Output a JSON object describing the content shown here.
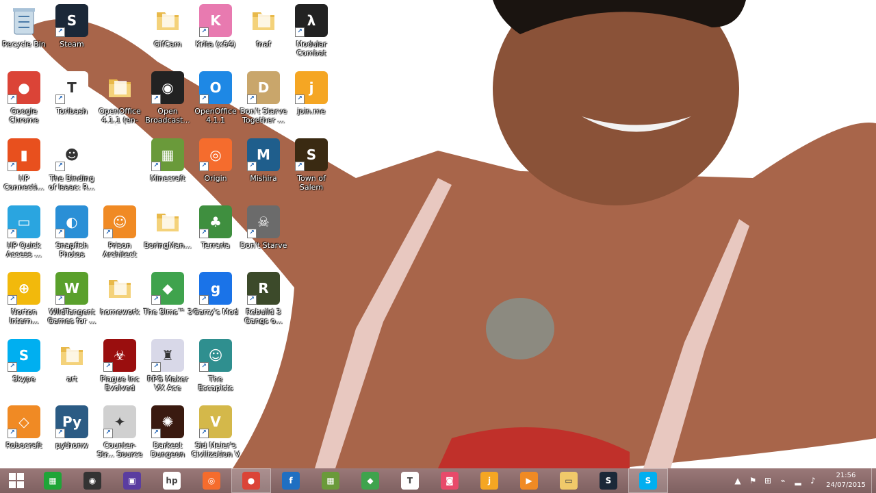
{
  "desktop": {
    "icons": [
      {
        "label": "Recycle Bin",
        "icon": "recycle-bin-icon",
        "color": "#8fb2cf",
        "glyph": "🗑",
        "shortcut": false
      },
      {
        "label": "Steam",
        "icon": "steam-icon",
        "color": "#1b2838",
        "glyph": "S",
        "shortcut": true
      },
      {
        "label": "GifCam",
        "icon": "folder-icon",
        "color": "#f0c96a",
        "glyph": "",
        "shortcut": false
      },
      {
        "label": "Krita (x64)",
        "icon": "krita-icon",
        "color": "#e87ab0",
        "glyph": "K",
        "shortcut": true
      },
      {
        "label": "fnaf",
        "icon": "folder-icon",
        "color": "#f0c96a",
        "glyph": "",
        "shortcut": false
      },
      {
        "label": "Modular Combat",
        "icon": "half-life-icon",
        "color": "#222222",
        "glyph": "λ",
        "shortcut": true
      },
      {
        "label": "Google Chrome",
        "icon": "chrome-icon",
        "color": "#db4437",
        "glyph": "●",
        "shortcut": true
      },
      {
        "label": "Toribash",
        "icon": "toribash-icon",
        "color": "#ffffff",
        "glyph": "T",
        "shortcut": true
      },
      {
        "label": "OpenOffice 4.1.1 (en-G...",
        "icon": "folder-icon",
        "color": "#f0c96a",
        "glyph": "",
        "shortcut": false
      },
      {
        "label": "Open Broadcast...",
        "icon": "obs-icon",
        "color": "#222222",
        "glyph": "◉",
        "shortcut": true
      },
      {
        "label": "OpenOffice 4.1.1",
        "icon": "openoffice-icon",
        "color": "#1e88e5",
        "glyph": "O",
        "shortcut": true
      },
      {
        "label": "Don't Starve Together ...",
        "icon": "dont-starve-together-icon",
        "color": "#c9a66b",
        "glyph": "D",
        "shortcut": true
      },
      {
        "label": "join.me",
        "icon": "joinme-icon",
        "color": "#f5a623",
        "glyph": "j",
        "shortcut": true
      },
      {
        "label": "HP Connecti...",
        "icon": "hp-connected-icon",
        "color": "#e8501e",
        "glyph": "▮",
        "shortcut": true
      },
      {
        "label": "The Binding of Isaac: R...",
        "icon": "isaac-icon",
        "color": "#ffffff",
        "glyph": "☻",
        "shortcut": true
      },
      {
        "label": "Minecraft",
        "icon": "minecraft-icon",
        "color": "#6a9a3a",
        "glyph": "▦",
        "shortcut": true
      },
      {
        "label": "Origin",
        "icon": "origin-icon",
        "color": "#f56c2d",
        "glyph": "◎",
        "shortcut": true
      },
      {
        "label": "Mishira",
        "icon": "mishira-icon",
        "color": "#1f5e8c",
        "glyph": "M",
        "shortcut": true
      },
      {
        "label": "Town of Salem",
        "icon": "town-of-salem-icon",
        "color": "#3a2a12",
        "glyph": "S",
        "shortcut": true
      },
      {
        "label": "HP Quick Access ...",
        "icon": "hp-quick-access-icon",
        "color": "#2aa5e0",
        "glyph": "▭",
        "shortcut": true
      },
      {
        "label": "Snapfish Photos",
        "icon": "snapfish-icon",
        "color": "#2a8fd6",
        "glyph": "◐",
        "shortcut": true
      },
      {
        "label": "Prison Architect",
        "icon": "prison-architect-icon",
        "color": "#f08a24",
        "glyph": "☺",
        "shortcut": true
      },
      {
        "label": "BoringMan...",
        "icon": "folder-icon",
        "color": "#f0c96a",
        "glyph": "",
        "shortcut": false
      },
      {
        "label": "Terraria",
        "icon": "terraria-icon",
        "color": "#3f8f3f",
        "glyph": "♣",
        "shortcut": true
      },
      {
        "label": "Don't Starve",
        "icon": "dont-starve-icon",
        "color": "#6b6b6b",
        "glyph": "☠",
        "shortcut": true
      },
      {
        "label": "Norton Intern...",
        "icon": "norton-icon",
        "color": "#f2b90c",
        "glyph": "⊕",
        "shortcut": true
      },
      {
        "label": "WildTangent Games for ...",
        "icon": "wildtangent-icon",
        "color": "#5aa02c",
        "glyph": "W",
        "shortcut": true
      },
      {
        "label": "homework",
        "icon": "folder-icon",
        "color": "#f0c96a",
        "glyph": "",
        "shortcut": false
      },
      {
        "label": "The Sims™ 3",
        "icon": "sims-icon",
        "color": "#3fa34d",
        "glyph": "◆",
        "shortcut": true
      },
      {
        "label": "Garry's Mod",
        "icon": "garrys-mod-icon",
        "color": "#1a73e8",
        "glyph": "g",
        "shortcut": true
      },
      {
        "label": "Rebuild 3 Gangs o...",
        "icon": "rebuild-icon",
        "color": "#3c4a2a",
        "glyph": "R",
        "shortcut": true
      },
      {
        "label": "Skype",
        "icon": "skype-icon",
        "color": "#00aff0",
        "glyph": "S",
        "shortcut": true
      },
      {
        "label": "art",
        "icon": "folder-icon",
        "color": "#f0c96a",
        "glyph": "",
        "shortcut": false
      },
      {
        "label": "Plague Inc Evolved",
        "icon": "plague-inc-icon",
        "color": "#9a0e0e",
        "glyph": "☣",
        "shortcut": true
      },
      {
        "label": "RPG Maker VX Ace",
        "icon": "rpg-maker-icon",
        "color": "#d8d8e8",
        "glyph": "♜",
        "shortcut": true
      },
      {
        "label": "The Escapists",
        "icon": "escapists-icon",
        "color": "#2f8f8f",
        "glyph": "☺",
        "shortcut": true
      },
      {
        "label": "Robocraft",
        "icon": "robocraft-icon",
        "color": "#f08a24",
        "glyph": "◇",
        "shortcut": true
      },
      {
        "label": "pythonw",
        "icon": "python-icon",
        "color": "#2b5b84",
        "glyph": "Py",
        "shortcut": true
      },
      {
        "label": "Counter-Str... Source",
        "icon": "counter-strike-icon",
        "color": "#d0d0d0",
        "glyph": "✦",
        "shortcut": true
      },
      {
        "label": "Darkest Dungeon",
        "icon": "darkest-dungeon-icon",
        "color": "#3a1a10",
        "glyph": "✺",
        "shortcut": true
      },
      {
        "label": "Sid Meier's Civilization V",
        "icon": "civilization-icon",
        "color": "#d4b84a",
        "glyph": "V",
        "shortcut": true
      }
    ]
  },
  "taskbar": {
    "buttons": [
      {
        "name": "store-icon",
        "color": "#1fa538",
        "glyph": "▦",
        "active": false
      },
      {
        "name": "camera-app-icon",
        "color": "#333333",
        "glyph": "◉",
        "active": false
      },
      {
        "name": "photos-app-icon",
        "color": "#5a3da0",
        "glyph": "▣",
        "active": false
      },
      {
        "name": "hp-icon",
        "color": "#ffffff",
        "glyph": "hp",
        "active": false
      },
      {
        "name": "origin-icon",
        "color": "#f56c2d",
        "glyph": "◎",
        "active": false
      },
      {
        "name": "chrome-icon",
        "color": "#db4437",
        "glyph": "●",
        "active": true
      },
      {
        "name": "firefox-icon",
        "color": "#1f6fc2",
        "glyph": "f",
        "active": false
      },
      {
        "name": "minecraft-icon",
        "color": "#6a9a3a",
        "glyph": "▦",
        "active": false
      },
      {
        "name": "sims-icon",
        "color": "#3fa34d",
        "glyph": "◆",
        "active": false
      },
      {
        "name": "toribash-icon",
        "color": "#ffffff",
        "glyph": "T",
        "active": false
      },
      {
        "name": "gifcam-icon",
        "color": "#e84a6a",
        "glyph": "◙",
        "active": false
      },
      {
        "name": "joinme-icon",
        "color": "#f5a623",
        "glyph": "j",
        "active": false
      },
      {
        "name": "media-player-icon",
        "color": "#f08a24",
        "glyph": "▶",
        "active": false
      },
      {
        "name": "file-explorer-icon",
        "color": "#f0c96a",
        "glyph": "▭",
        "active": false
      },
      {
        "name": "steam-icon",
        "color": "#1b2838",
        "glyph": "S",
        "active": false
      },
      {
        "name": "skype-icon",
        "color": "#00aff0",
        "glyph": "S",
        "active": true
      }
    ],
    "tray": {
      "icons": [
        "show-hidden-icons-icon",
        "flag-icon",
        "windows-icon",
        "usb-icon",
        "network-icon",
        "volume-icon"
      ],
      "time": "21:56",
      "date": "24/07/2015"
    }
  }
}
